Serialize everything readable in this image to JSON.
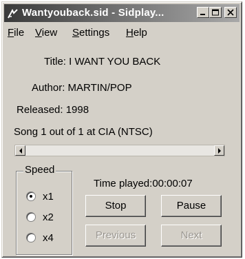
{
  "window": {
    "title": "Wantyouback.sid - Sidplay..."
  },
  "menu": {
    "file": {
      "mnemonic": "F",
      "rest": "ile"
    },
    "view": {
      "mnemonic": "V",
      "rest": "iew"
    },
    "settings": {
      "mnemonic": "S",
      "rest": "ettings"
    },
    "help": {
      "mnemonic": "H",
      "rest": "elp"
    }
  },
  "info": {
    "title": "Title: I WANT YOU BACK",
    "author": "Author: MARTIN/POP",
    "released": "Released: 1998",
    "song": "Song 1 out of 1 at CIA (NTSC)"
  },
  "speed": {
    "label": "Speed",
    "options": [
      "x1",
      "x2",
      "x4"
    ],
    "selected": "x1"
  },
  "time_played": "Time played:00:00:07",
  "buttons": {
    "stop": "Stop",
    "pause": "Pause",
    "previous": "Previous",
    "next": "Next"
  },
  "icons": {
    "app": "sidplay-app-icon",
    "minimize": "minimize-icon",
    "maximize": "maximize-icon",
    "close": "close-icon",
    "slider_left": "arrow-left-icon",
    "slider_right": "arrow-right-icon"
  }
}
